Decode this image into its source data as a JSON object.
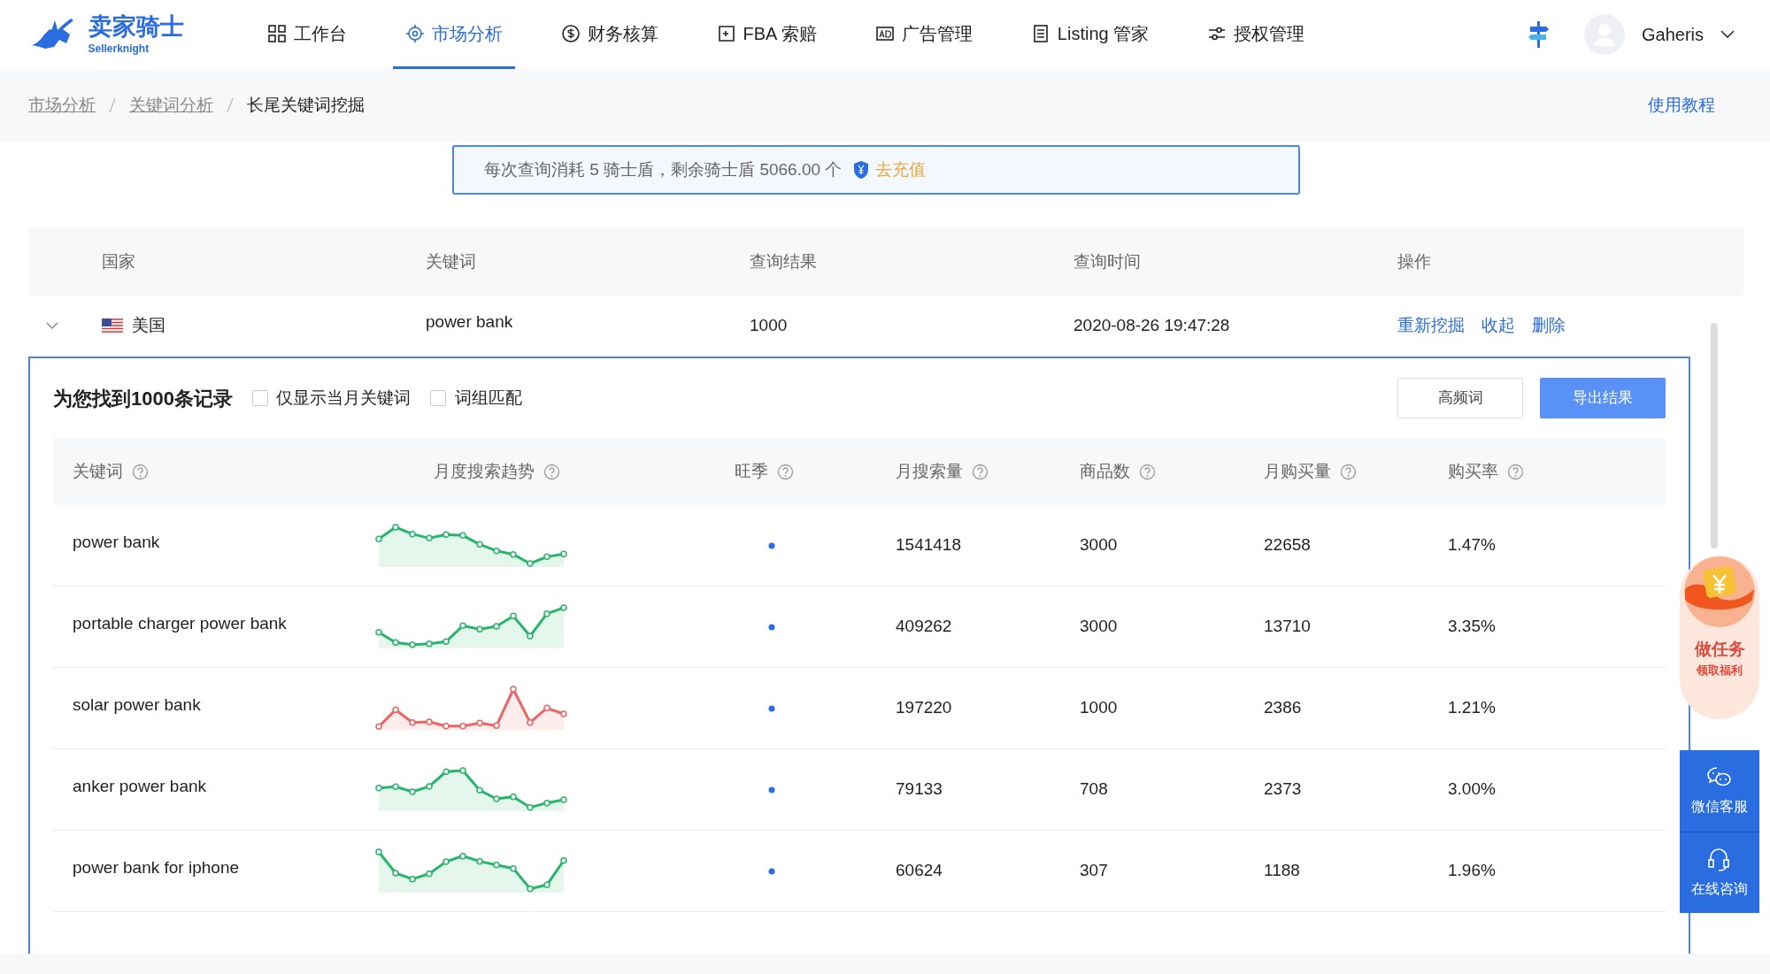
{
  "header": {
    "logo": {
      "name": "卖家骑士",
      "subtitle": "Sellerknight"
    },
    "nav": [
      {
        "label": "工作台",
        "selected": false
      },
      {
        "label": "市场分析",
        "selected": true
      },
      {
        "label": "财务核算",
        "selected": false
      },
      {
        "label": "FBA 索赔",
        "selected": false
      },
      {
        "label": "广告管理",
        "selected": false
      },
      {
        "label": "Listing 管家",
        "selected": false
      },
      {
        "label": "授权管理",
        "selected": false
      }
    ],
    "user": {
      "name": "Gaheris"
    }
  },
  "breadcrumb": [
    "市场分析",
    "关键词分析",
    "长尾关键词挖掘"
  ],
  "help_link": "使用教程",
  "notice": {
    "text": "每次查询消耗 5 骑士盾，剩余骑士盾 5066.00 个",
    "link": "去充值"
  },
  "query_table": {
    "columns": [
      "国家",
      "关键词",
      "查询结果",
      "查询时间",
      "操作"
    ],
    "rows": [
      {
        "expanded": true,
        "country": "美国",
        "keyword": "power bank",
        "results": "1000",
        "time": "2020-08-26 19:47:28",
        "actions": [
          "重新挖掘",
          "收起",
          "删除"
        ]
      }
    ]
  },
  "results": {
    "title": "为您找到1000条记录",
    "filters": [
      {
        "label": "仅显示当月关键词",
        "checked": false
      },
      {
        "label": "词组匹配",
        "checked": false
      }
    ],
    "buttons": [
      {
        "label": "高频词",
        "kind": "default"
      },
      {
        "label": "导出结果",
        "kind": "primary"
      }
    ],
    "columns": [
      "关键词",
      "月度搜索趋势",
      "旺季",
      "月搜索量",
      "商品数",
      "月购买量",
      "购买率"
    ],
    "rows": [
      {
        "keyword": "power bank",
        "color": "#27b56b",
        "search_volume": "1541418",
        "products": "3000",
        "purchases": "22658",
        "purchase_rate": "1.47%"
      },
      {
        "keyword": "portable charger power bank",
        "color": "#27b56b",
        "search_volume": "409262",
        "products": "3000",
        "purchases": "13710",
        "purchase_rate": "3.35%"
      },
      {
        "keyword": "solar power bank",
        "color": "#ec6464",
        "search_volume": "197220",
        "products": "1000",
        "purchases": "2386",
        "purchase_rate": "1.21%"
      },
      {
        "keyword": "anker power bank",
        "color": "#27b56b",
        "search_volume": "79133",
        "products": "708",
        "purchases": "2373",
        "purchase_rate": "3.00%"
      },
      {
        "keyword": "power bank for iphone",
        "color": "#27b56b",
        "search_volume": "60624",
        "products": "307",
        "purchases": "1188",
        "purchase_rate": "1.96%"
      }
    ]
  },
  "side_widgets": {
    "task": {
      "title": "做任务",
      "subtitle": "领取福利"
    },
    "services": [
      "微信客服",
      "在线咨询"
    ]
  }
}
